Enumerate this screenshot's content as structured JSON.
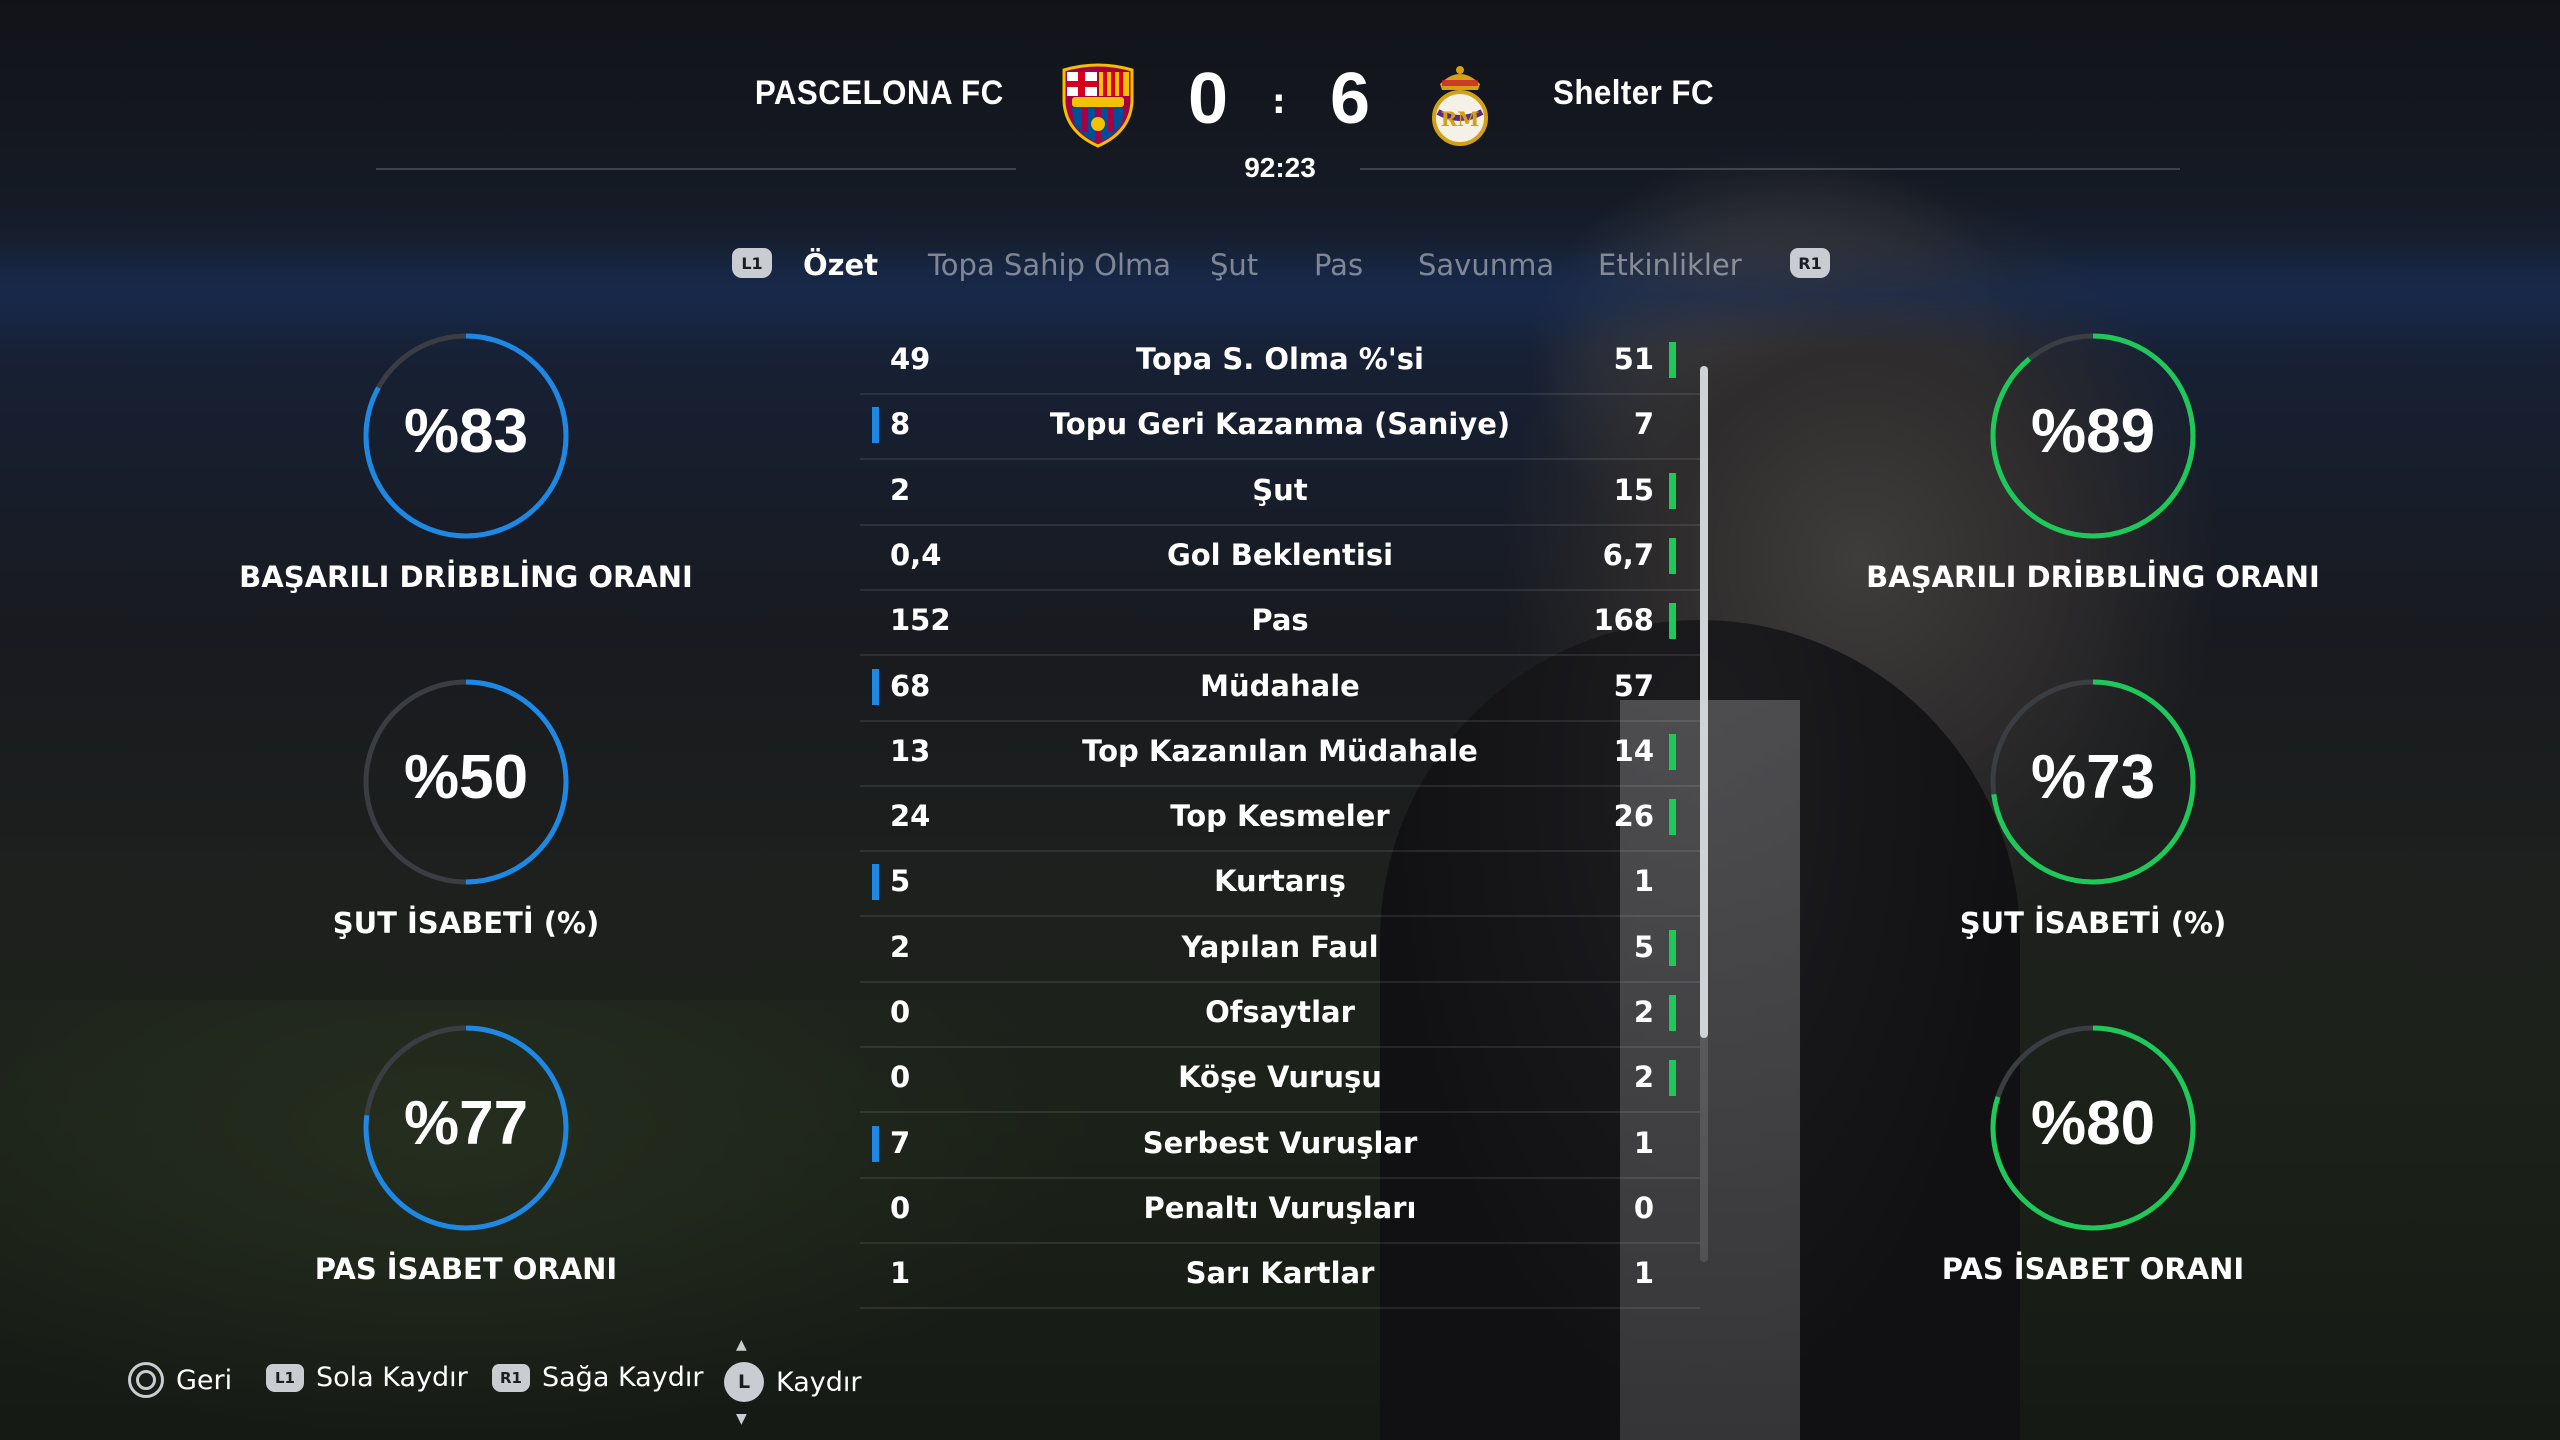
{
  "match": {
    "home_team": "PASCELONA FC",
    "away_team": "Shelter FC",
    "home_score": "0",
    "away_score": "6",
    "separator": ":",
    "clock": "92:23",
    "home_crest": "fc-barcelona-crest",
    "away_crest": "real-madrid-crest"
  },
  "tabs": {
    "left_shoulder": "L1",
    "right_shoulder": "R1",
    "items": [
      {
        "label": "Özet",
        "active": true
      },
      {
        "label": "Topa Sahip Olma",
        "active": false
      },
      {
        "label": "Şut",
        "active": false
      },
      {
        "label": "Pas",
        "active": false
      },
      {
        "label": "Savunma",
        "active": false
      },
      {
        "label": "Etkinlikler",
        "active": false
      }
    ]
  },
  "stats": [
    {
      "home": "49",
      "label": "Topa S. Olma %'si",
      "away": "51",
      "leader": "away"
    },
    {
      "home": "8",
      "label": "Topu Geri Kazanma (Saniye)",
      "away": "7",
      "leader": "home"
    },
    {
      "home": "2",
      "label": "Şut",
      "away": "15",
      "leader": "away"
    },
    {
      "home": "0,4",
      "label": "Gol Beklentisi",
      "away": "6,7",
      "leader": "away"
    },
    {
      "home": "152",
      "label": "Pas",
      "away": "168",
      "leader": "away"
    },
    {
      "home": "68",
      "label": "Müdahale",
      "away": "57",
      "leader": "home"
    },
    {
      "home": "13",
      "label": "Top Kazanılan Müdahale",
      "away": "14",
      "leader": "away"
    },
    {
      "home": "24",
      "label": "Top Kesmeler",
      "away": "26",
      "leader": "away"
    },
    {
      "home": "5",
      "label": "Kurtarış",
      "away": "1",
      "leader": "home"
    },
    {
      "home": "2",
      "label": "Yapılan Faul",
      "away": "5",
      "leader": "away"
    },
    {
      "home": "0",
      "label": "Ofsaytlar",
      "away": "2",
      "leader": "away"
    },
    {
      "home": "0",
      "label": "Köşe Vuruşu",
      "away": "2",
      "leader": "away"
    },
    {
      "home": "7",
      "label": "Serbest Vuruşlar",
      "away": "1",
      "leader": "home"
    },
    {
      "home": "0",
      "label": "Penaltı Vuruşları",
      "away": "0",
      "leader": "none"
    },
    {
      "home": "1",
      "label": "Sarı Kartlar",
      "away": "1",
      "leader": "none"
    }
  ],
  "home_rings": [
    {
      "value": "%83",
      "percent": 83,
      "label": "BAŞARILI DRİBBLİNG ORANI"
    },
    {
      "value": "%50",
      "percent": 50,
      "label": "ŞUT İSABETİ (%)"
    },
    {
      "value": "%77",
      "percent": 77,
      "label": "PAS İSABET ORANI"
    }
  ],
  "away_rings": [
    {
      "value": "%89",
      "percent": 89,
      "label": "BAŞARILI DRİBBLİNG ORANI"
    },
    {
      "value": "%73",
      "percent": 73,
      "label": "ŞUT İSABETİ (%)"
    },
    {
      "value": "%80",
      "percent": 80,
      "label": "PAS İSABET ORANI"
    }
  ],
  "colors": {
    "home": "#1e88e5",
    "away": "#1ec95a",
    "ring_track": "#3a3d42"
  },
  "footer": {
    "back": {
      "icon": "circle-button-icon",
      "label": "Geri"
    },
    "left": {
      "icon": "l1-button-icon",
      "button": "L1",
      "label": "Sola Kaydır"
    },
    "right": {
      "icon": "r1-button-icon",
      "button": "R1",
      "label": "Sağa Kaydır"
    },
    "scroll": {
      "icon": "left-stick-icon",
      "button": "L",
      "label": "Kaydır"
    }
  }
}
